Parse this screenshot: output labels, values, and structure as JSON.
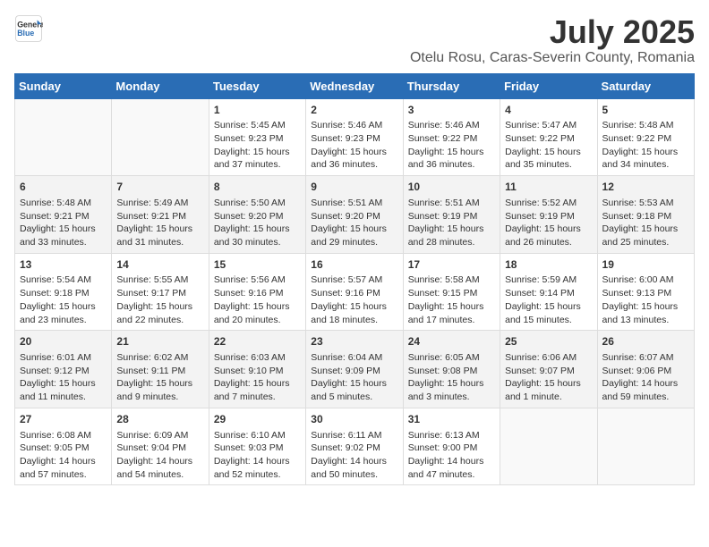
{
  "logo": {
    "line1": "General",
    "line2": "Blue"
  },
  "title": "July 2025",
  "location": "Otelu Rosu, Caras-Severin County, Romania",
  "weekdays": [
    "Sunday",
    "Monday",
    "Tuesday",
    "Wednesday",
    "Thursday",
    "Friday",
    "Saturday"
  ],
  "weeks": [
    [
      {
        "day": "",
        "lines": []
      },
      {
        "day": "",
        "lines": []
      },
      {
        "day": "1",
        "lines": [
          "Sunrise: 5:45 AM",
          "Sunset: 9:23 PM",
          "Daylight: 15 hours",
          "and 37 minutes."
        ]
      },
      {
        "day": "2",
        "lines": [
          "Sunrise: 5:46 AM",
          "Sunset: 9:23 PM",
          "Daylight: 15 hours",
          "and 36 minutes."
        ]
      },
      {
        "day": "3",
        "lines": [
          "Sunrise: 5:46 AM",
          "Sunset: 9:22 PM",
          "Daylight: 15 hours",
          "and 36 minutes."
        ]
      },
      {
        "day": "4",
        "lines": [
          "Sunrise: 5:47 AM",
          "Sunset: 9:22 PM",
          "Daylight: 15 hours",
          "and 35 minutes."
        ]
      },
      {
        "day": "5",
        "lines": [
          "Sunrise: 5:48 AM",
          "Sunset: 9:22 PM",
          "Daylight: 15 hours",
          "and 34 minutes."
        ]
      }
    ],
    [
      {
        "day": "6",
        "lines": [
          "Sunrise: 5:48 AM",
          "Sunset: 9:21 PM",
          "Daylight: 15 hours",
          "and 33 minutes."
        ]
      },
      {
        "day": "7",
        "lines": [
          "Sunrise: 5:49 AM",
          "Sunset: 9:21 PM",
          "Daylight: 15 hours",
          "and 31 minutes."
        ]
      },
      {
        "day": "8",
        "lines": [
          "Sunrise: 5:50 AM",
          "Sunset: 9:20 PM",
          "Daylight: 15 hours",
          "and 30 minutes."
        ]
      },
      {
        "day": "9",
        "lines": [
          "Sunrise: 5:51 AM",
          "Sunset: 9:20 PM",
          "Daylight: 15 hours",
          "and 29 minutes."
        ]
      },
      {
        "day": "10",
        "lines": [
          "Sunrise: 5:51 AM",
          "Sunset: 9:19 PM",
          "Daylight: 15 hours",
          "and 28 minutes."
        ]
      },
      {
        "day": "11",
        "lines": [
          "Sunrise: 5:52 AM",
          "Sunset: 9:19 PM",
          "Daylight: 15 hours",
          "and 26 minutes."
        ]
      },
      {
        "day": "12",
        "lines": [
          "Sunrise: 5:53 AM",
          "Sunset: 9:18 PM",
          "Daylight: 15 hours",
          "and 25 minutes."
        ]
      }
    ],
    [
      {
        "day": "13",
        "lines": [
          "Sunrise: 5:54 AM",
          "Sunset: 9:18 PM",
          "Daylight: 15 hours",
          "and 23 minutes."
        ]
      },
      {
        "day": "14",
        "lines": [
          "Sunrise: 5:55 AM",
          "Sunset: 9:17 PM",
          "Daylight: 15 hours",
          "and 22 minutes."
        ]
      },
      {
        "day": "15",
        "lines": [
          "Sunrise: 5:56 AM",
          "Sunset: 9:16 PM",
          "Daylight: 15 hours",
          "and 20 minutes."
        ]
      },
      {
        "day": "16",
        "lines": [
          "Sunrise: 5:57 AM",
          "Sunset: 9:16 PM",
          "Daylight: 15 hours",
          "and 18 minutes."
        ]
      },
      {
        "day": "17",
        "lines": [
          "Sunrise: 5:58 AM",
          "Sunset: 9:15 PM",
          "Daylight: 15 hours",
          "and 17 minutes."
        ]
      },
      {
        "day": "18",
        "lines": [
          "Sunrise: 5:59 AM",
          "Sunset: 9:14 PM",
          "Daylight: 15 hours",
          "and 15 minutes."
        ]
      },
      {
        "day": "19",
        "lines": [
          "Sunrise: 6:00 AM",
          "Sunset: 9:13 PM",
          "Daylight: 15 hours",
          "and 13 minutes."
        ]
      }
    ],
    [
      {
        "day": "20",
        "lines": [
          "Sunrise: 6:01 AM",
          "Sunset: 9:12 PM",
          "Daylight: 15 hours",
          "and 11 minutes."
        ]
      },
      {
        "day": "21",
        "lines": [
          "Sunrise: 6:02 AM",
          "Sunset: 9:11 PM",
          "Daylight: 15 hours",
          "and 9 minutes."
        ]
      },
      {
        "day": "22",
        "lines": [
          "Sunrise: 6:03 AM",
          "Sunset: 9:10 PM",
          "Daylight: 15 hours",
          "and 7 minutes."
        ]
      },
      {
        "day": "23",
        "lines": [
          "Sunrise: 6:04 AM",
          "Sunset: 9:09 PM",
          "Daylight: 15 hours",
          "and 5 minutes."
        ]
      },
      {
        "day": "24",
        "lines": [
          "Sunrise: 6:05 AM",
          "Sunset: 9:08 PM",
          "Daylight: 15 hours",
          "and 3 minutes."
        ]
      },
      {
        "day": "25",
        "lines": [
          "Sunrise: 6:06 AM",
          "Sunset: 9:07 PM",
          "Daylight: 15 hours",
          "and 1 minute."
        ]
      },
      {
        "day": "26",
        "lines": [
          "Sunrise: 6:07 AM",
          "Sunset: 9:06 PM",
          "Daylight: 14 hours",
          "and 59 minutes."
        ]
      }
    ],
    [
      {
        "day": "27",
        "lines": [
          "Sunrise: 6:08 AM",
          "Sunset: 9:05 PM",
          "Daylight: 14 hours",
          "and 57 minutes."
        ]
      },
      {
        "day": "28",
        "lines": [
          "Sunrise: 6:09 AM",
          "Sunset: 9:04 PM",
          "Daylight: 14 hours",
          "and 54 minutes."
        ]
      },
      {
        "day": "29",
        "lines": [
          "Sunrise: 6:10 AM",
          "Sunset: 9:03 PM",
          "Daylight: 14 hours",
          "and 52 minutes."
        ]
      },
      {
        "day": "30",
        "lines": [
          "Sunrise: 6:11 AM",
          "Sunset: 9:02 PM",
          "Daylight: 14 hours",
          "and 50 minutes."
        ]
      },
      {
        "day": "31",
        "lines": [
          "Sunrise: 6:13 AM",
          "Sunset: 9:00 PM",
          "Daylight: 14 hours",
          "and 47 minutes."
        ]
      },
      {
        "day": "",
        "lines": []
      },
      {
        "day": "",
        "lines": []
      }
    ]
  ]
}
